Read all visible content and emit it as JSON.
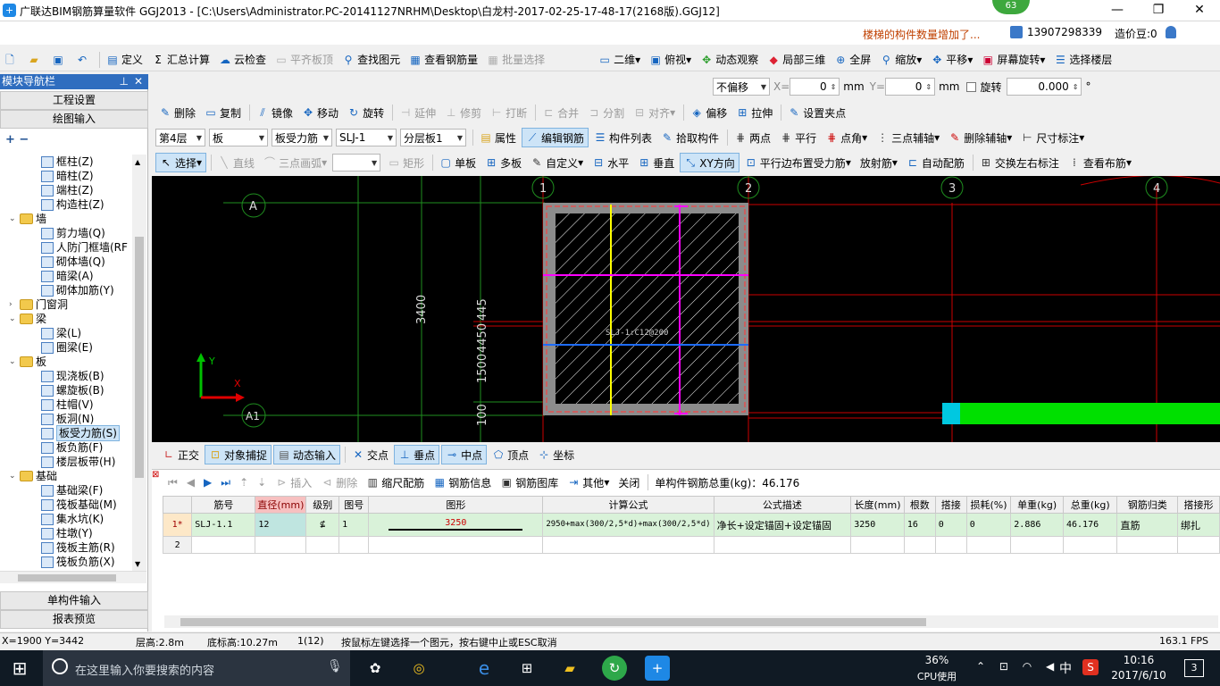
{
  "title_bar": {
    "logo": "+",
    "title": "广联达BIM钢筋算量软件 GGJ2013 - [C:\\Users\\Administrator.PC-20141127NRHM\\Desktop\\白龙村-2017-02-25-17-48-17(2168版).GGJ12]",
    "badge": "63",
    "min": "—",
    "max": "❐",
    "close": "✕"
  },
  "info_bar": {
    "notice": "楼梯的构件数量增加了...",
    "phone": "13907298339",
    "coins": "造价豆:0"
  },
  "main_toolbar": {
    "items": [
      "定义",
      "汇总计算",
      "云检查",
      "平齐板顶",
      "查找图元",
      "查看钢筋量",
      "批量选择"
    ],
    "right_items": [
      "二维",
      "俯视",
      "动态观察",
      "局部三维",
      "全屏",
      "缩放",
      "平移",
      "屏幕旋转",
      "选择楼层"
    ]
  },
  "offset_toolbar": {
    "mode": "不偏移",
    "x_label": "X=",
    "x_value": "0",
    "y_label": "Y=",
    "y_value": "0",
    "unit": "mm",
    "rotate_label": "旋转",
    "rotate_value": "0.000",
    "degree": "°"
  },
  "nav_panel": {
    "header": "模块导航栏",
    "top_buttons": [
      "工程设置",
      "绘图输入"
    ],
    "bottom_buttons": [
      "单构件输入",
      "报表预览"
    ],
    "tree": [
      {
        "label": "框柱(Z)",
        "level": 2
      },
      {
        "label": "暗柱(Z)",
        "level": 2
      },
      {
        "label": "端柱(Z)",
        "level": 2
      },
      {
        "label": "构造柱(Z)",
        "level": 2
      },
      {
        "label": "墙",
        "level": 1,
        "folder": true,
        "expand": "⌄"
      },
      {
        "label": "剪力墙(Q)",
        "level": 2
      },
      {
        "label": "人防门框墙(RF",
        "level": 2
      },
      {
        "label": "砌体墙(Q)",
        "level": 2
      },
      {
        "label": "暗梁(A)",
        "level": 2
      },
      {
        "label": "砌体加筋(Y)",
        "level": 2
      },
      {
        "label": "门窗洞",
        "level": 1,
        "folder": true,
        "expand": "›"
      },
      {
        "label": "梁",
        "level": 1,
        "folder": true,
        "expand": "⌄"
      },
      {
        "label": "梁(L)",
        "level": 2
      },
      {
        "label": "圈梁(E)",
        "level": 2
      },
      {
        "label": "板",
        "level": 1,
        "folder": true,
        "expand": "⌄"
      },
      {
        "label": "现浇板(B)",
        "level": 2
      },
      {
        "label": "螺旋板(B)",
        "level": 2
      },
      {
        "label": "柱帽(V)",
        "level": 2
      },
      {
        "label": "板洞(N)",
        "level": 2
      },
      {
        "label": "板受力筋(S)",
        "level": 2,
        "selected": true
      },
      {
        "label": "板负筋(F)",
        "level": 2
      },
      {
        "label": "楼层板带(H)",
        "level": 2
      },
      {
        "label": "基础",
        "level": 1,
        "folder": true,
        "expand": "⌄"
      },
      {
        "label": "基础梁(F)",
        "level": 2
      },
      {
        "label": "筏板基础(M)",
        "level": 2
      },
      {
        "label": "集水坑(K)",
        "level": 2
      },
      {
        "label": "柱墩(Y)",
        "level": 2
      },
      {
        "label": "筏板主筋(R)",
        "level": 2
      },
      {
        "label": "筏板负筋(X)",
        "level": 2
      }
    ]
  },
  "edit_toolbar": {
    "items": [
      "删除",
      "复制",
      "镜像",
      "移动",
      "旋转",
      "延伸",
      "修剪",
      "打断",
      "合并",
      "分割",
      "对齐",
      "偏移",
      "拉伸",
      "设置夹点"
    ]
  },
  "layer_toolbar": {
    "floor": "第4层",
    "category": "板",
    "type": "板受力筋",
    "member": "SLJ-1",
    "layer": "分层板1",
    "items": [
      "属性",
      "编辑钢筋",
      "构件列表",
      "拾取构件",
      "两点",
      "平行",
      "点角",
      "三点辅轴",
      "删除辅轴",
      "尺寸标注"
    ]
  },
  "draw_toolbar": {
    "items": [
      "选择",
      "直线",
      "三点画弧",
      "矩形",
      "单板",
      "多板",
      "自定义",
      "水平",
      "垂直",
      "XY方向",
      "平行边布置受力筋",
      "放射筋",
      "自动配筋",
      "交换左右标注",
      "查看布筋"
    ]
  },
  "canvas": {
    "axes_top": [
      "1",
      "2",
      "3",
      "4"
    ],
    "axes_left": [
      "A",
      "A1"
    ],
    "dims": [
      "3400",
      "1500",
      "100",
      "445",
      "4450"
    ],
    "rebar_label": "SLJ-1:C12@200",
    "ucs_x": "X",
    "ucs_y": "Y"
  },
  "snap_toolbar": {
    "items": [
      "正交",
      "对象捕捉",
      "动态输入",
      "交点",
      "垂点",
      "中点",
      "顶点",
      "坐标"
    ]
  },
  "rebar_toolbar": {
    "items": [
      "插入",
      "删除",
      "缩尺配筋",
      "钢筋信息",
      "钢筋图库",
      "其他",
      "关闭"
    ],
    "total": "单构件钢筋总重(kg)：46.176"
  },
  "rebar_table": {
    "headers": [
      "筋号",
      "直径(mm)",
      "级别",
      "图号",
      "图形",
      "计算公式",
      "公式描述",
      "长度(mm)",
      "根数",
      "搭接",
      "损耗(%)",
      "单重(kg)",
      "总重(kg)",
      "钢筋归类",
      "搭接形"
    ],
    "rows": [
      {
        "idx": "1*",
        "bar": "SLJ-1.1",
        "dia": "12",
        "grade": "⊈",
        "fig": "1",
        "shape": "3250",
        "formula": "2950+max(300/2,5*d)+max(300/2,5*d)",
        "desc": "净长+设定锚固+设定锚固",
        "len": "3250",
        "count": "16",
        "lap": "0",
        "loss": "0",
        "unit_w": "2.886",
        "total_w": "46.176",
        "cat": "直筋",
        "lap_type": "绑扎"
      },
      {
        "idx": "2",
        "bar": "",
        "dia": "",
        "grade": "",
        "fig": "",
        "shape": "",
        "formula": "",
        "desc": "",
        "len": "",
        "count": "",
        "lap": "",
        "loss": "",
        "unit_w": "",
        "total_w": "",
        "cat": "",
        "lap_type": ""
      }
    ]
  },
  "status_bar": {
    "coords": "X=1900 Y=3442",
    "height": "层高:2.8m",
    "bottom_height": "底标高:10.27m",
    "count": "1(12)",
    "hint": "按鼠标左键选择一个图元，按右键中止或ESC取消",
    "fps": "163.1 FPS"
  },
  "taskbar": {
    "search": "在这里输入你要搜索的内容",
    "cpu_pct": "36%",
    "cpu_label": "CPU使用",
    "time": "10:16",
    "date": "2017/6/10",
    "ime": "中",
    "notif": "3"
  },
  "colors": {
    "nav_header": "#2f6dbf",
    "canvas_bg": "#000000",
    "row_highlight": "#d9f2d9",
    "taskbar": "#101a24"
  }
}
